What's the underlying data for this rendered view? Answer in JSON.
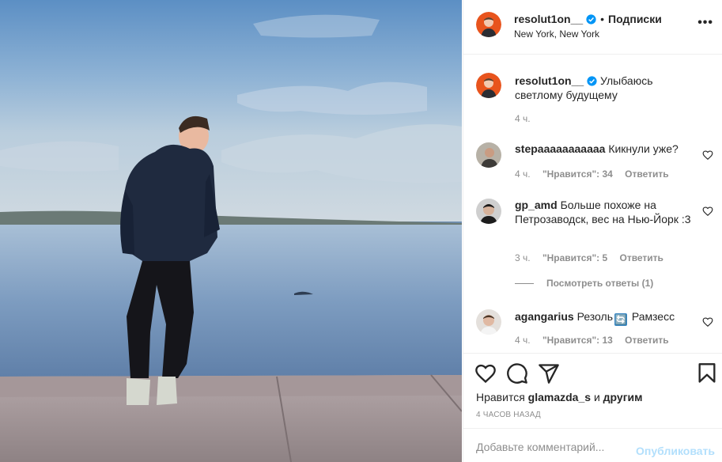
{
  "post": {
    "photo_alt": "",
    "author": "resolut1on__",
    "follow_label": "Подписки",
    "location": "New York, New York",
    "more_label": "•••"
  },
  "comments": [
    {
      "author": "resolut1on__",
      "text": "Улыбаюсь светлому будущему",
      "time": "4 ч.",
      "avatar": "avatar-orange"
    },
    {
      "author": "stepaaaaaaaaaaa",
      "text": "Кикнули уже?",
      "time": "4 ч.",
      "likes": "\"Нравится\": 34",
      "reply": "Ответить"
    },
    {
      "author": "gp_amd",
      "text": "Больше похоже на Петрозаводск, вес на Нью-Йорк :3",
      "time": "3 ч.",
      "likes": "\"Нравится\": 5",
      "reply": "Ответить",
      "view_replies": "Посмотреть ответы (1)"
    },
    {
      "author": "agangarius",
      "text_before": "Резоль",
      "text_after": "Рамзесс",
      "time": "4 ч.",
      "likes": "\"Нравится\": 13",
      "reply": "Ответить"
    }
  ],
  "actions": {
    "likes_prefix": "Нравится",
    "likes_user": "glamazda_s",
    "likes_mid": "и",
    "likes_suffix": "другим",
    "time_ago": "4 ЧАСОВ НАЗАД"
  },
  "add_comment": {
    "placeholder": "Добавьте комментарий...",
    "publish_label": "Опубликовать"
  },
  "colors": {
    "verified": "#0095f6",
    "avatar_bg": "#e8541d",
    "publish_disabled": "#b2dffc"
  }
}
